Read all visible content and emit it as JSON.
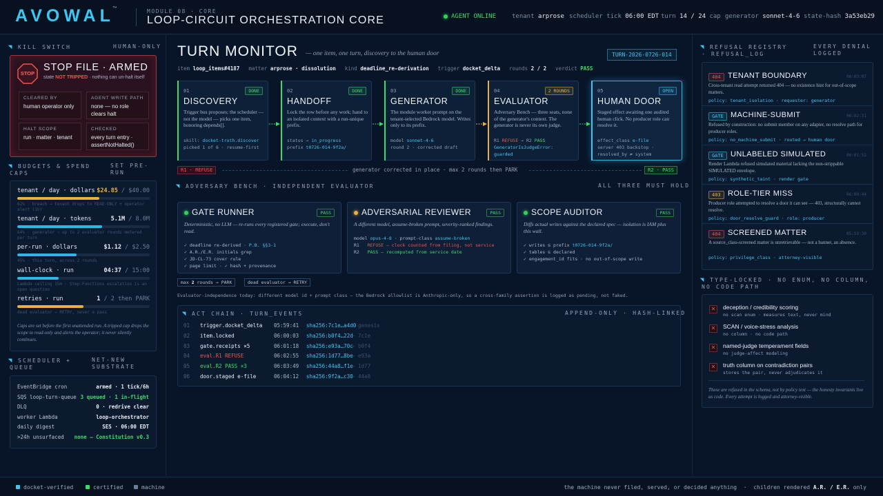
{
  "header": {
    "brand": "AVOWAL",
    "tm": "™",
    "module": "MODULE 08 · CORE",
    "title": "LOOP-CIRCUIT ORCHESTRATION CORE",
    "agent": "AGENT ONLINE",
    "tenant_l": "tenant",
    "tenant_v": "arprose",
    "tick_l": "scheduler tick",
    "tick_v": "06:00 EDT",
    "turn_l": "turn",
    "turn_v": "14 / 24",
    "turn_s": "cap",
    "gen_l": "generator",
    "gen_v": "sonnet-4-6",
    "hash_l": "state-hash",
    "hash_v": "3a53eb29"
  },
  "kill": {
    "head": "KILL SWITCH",
    "mode": "HUMAN-ONLY",
    "stop": "STOP",
    "title": "STOP FILE · ARMED",
    "sub1": "state",
    "sub2": "NOT TRIPPED",
    "sub3": "· nothing can un-halt itself",
    "b1l": "CLEARED BY",
    "b1v": "human operator only",
    "b2l": "AGENT WRITE PATH",
    "b2v": "none — no role clears halt",
    "b3l": "HALT SCOPE",
    "b3v": "run · matter · tenant",
    "b4l": "CHECKED",
    "b4v": "every turn entry · assertNotHalted()"
  },
  "budgets": {
    "head": "BUDGETS & SPEND CAPS",
    "right": "SET PRE-RUN",
    "rows": [
      {
        "label": "tenant / day · dollars",
        "value": "$24.85",
        "cap": "/ $40.00",
        "note": "62% · breach → tenant drops to READ-ONLY + operator alert (1h)",
        "fill": 0.62,
        "color": "#eab13d"
      },
      {
        "label": "tenant / day · tokens",
        "value": "5.1M",
        "cap": "/ 8.0M",
        "note": "64% · generator ~ up to 2 evaluator rounds metered per turn",
        "fill": 0.64,
        "color": "#30b6e6"
      },
      {
        "label": "per-run · dollars",
        "value": "$1.12",
        "cap": "/ $2.50",
        "note": "45% · this turn, across 2 rounds",
        "fill": 0.45,
        "color": "#30b6e6"
      },
      {
        "label": "wall-clock · run",
        "value": "04:37",
        "cap": "/ 15:00",
        "note": "Lambda ceiling 15m · Step-Functions escalation is an open question",
        "fill": 0.31,
        "color": "#30b6e6"
      },
      {
        "label": "retries · run",
        "value": "1",
        "cap": "/ 2  then PARK",
        "note": "dead evaluator → RETRY, never a pass",
        "fill": 0.5,
        "color": "#eab13d"
      }
    ],
    "foot": "Caps are set before the first unattended run. A tripped cap drops the scope to read-only and alerts the operator; it never silently continues."
  },
  "sched": {
    "head": "SCHEDULER + QUEUE",
    "right": "NET-NEW SUBSTRATE",
    "rows": [
      {
        "k": "EventBridge cron",
        "v": "armed · 1 tick/6h",
        "c": "#e8eef8"
      },
      {
        "k": "SQS loop-turn-queue",
        "v": "3 queued · 1 in-flight",
        "c": "#3ddc6a"
      },
      {
        "k": "DLQ",
        "v": "0 · redrive clear",
        "c": "#e8eef8"
      },
      {
        "k": "worker Lambda",
        "v": "loop-orchestrator",
        "c": "#e8eef8"
      },
      {
        "k": "daily digest",
        "v": "SES · 06:00 EDT",
        "c": "#e8eef8"
      },
      {
        "k": ">24h unsurfaced",
        "v": "none — Constitution v0.3",
        "c": "#3ddc6a"
      }
    ]
  },
  "turn": {
    "title": "TURN MONITOR",
    "tag": "— one item, one turn, discovery to the human door",
    "id": "TURN-2026-0726-014",
    "meta": [
      {
        "k": "item",
        "v": "loop_items#4187"
      },
      {
        "k": "matter",
        "v": "arprose · dissolution"
      },
      {
        "k": "kind",
        "v": "deadline_re-derivation"
      },
      {
        "k": "trigger",
        "v": "docket_delta"
      },
      {
        "k": "rounds",
        "v": "2 / 2"
      },
      {
        "k": "verdict",
        "v": "PASS"
      }
    ]
  },
  "stages": [
    {
      "num": "01",
      "badge": "DONE",
      "title": "DISCOVERY",
      "desc": "Trigger bus proposes; the scheduler — not the model — picks one item, honoring depends[].",
      "m1": "skill: ",
      "m1v": "docket-truth.discover",
      "m2": "picked 1 of 6 · resume-first"
    },
    {
      "num": "02",
      "badge": "DONE",
      "title": "HANDOFF",
      "desc": "Lock the row before any work; hand to an isolated context with a run-unique prefix.",
      "m1": "status → ",
      "m1v": "in_progress",
      "m2": "prefix ",
      "m2v": "t0726-014-9f2a/"
    },
    {
      "num": "03",
      "badge": "DONE",
      "title": "GENERATOR",
      "desc": "The module worker prompt on the tenant-selected Bedrock model. Writes only to its prefix.",
      "m1": "model ",
      "m1v": "sonnet-4-6",
      "m2": "round 2 · corrected draft"
    },
    {
      "num": "04",
      "badge": "2 ROUNDS",
      "title": "EVALUATOR",
      "desc": "Adversary Bench — three seats, none of the generator's context. The generator is never its own judge.",
      "m1": "R1 ",
      "m1r": "REFUSE",
      "m1b": " → R2 ",
      "m1g": "PASS",
      "m2v": "GeneratorIsJudgeError:",
      "m3v": "guarded"
    },
    {
      "num": "05",
      "badge": "OPEN",
      "title": "HUMAN DOOR",
      "desc": "Staged effect awaiting one audited human click. No producer role can resolve it.",
      "m1": "effect_class ",
      "m1v": "e-file",
      "m2": "server 403 backstop ·",
      "m3": "resolved_by ≠ system"
    }
  ],
  "rounds": {
    "r1": "R1 · REFUSE",
    "mid": "generator corrected in place · max 2 rounds then PARK",
    "r2": "R2 · PASS"
  },
  "bench": {
    "head": "ADVERSARY BENCH · INDEPENDENT EVALUATOR",
    "right": "ALL THREE MUST HOLD",
    "pass": "PASS",
    "gate": {
      "title": "GATE RUNNER",
      "desc": "Deterministic, no LLM — re-runs every registered gate; execute, don't read.",
      "lines": [
        "✓ deadline re-derived · ",
        "✓ A.R./E.R. initials grep",
        "✓ JD-CL-73 cover rule",
        "✓ page limit · ✓ hash + provenance"
      ],
      "l1v": "P.B. §§3-1"
    },
    "adv": {
      "title": "ADVERSARIAL REVIEWER",
      "desc": "A different model, assume-broken prompt, severity-ranked findings.",
      "model_l": "model ",
      "model_v": "opus-4-8",
      "pc_l": " · prompt-class ",
      "pc_v": "assume-broken",
      "r1": "R1",
      "r1v": "REFUSE — clock counted from filing, not service",
      "r2": "R2",
      "r2v": "PASS — recomputed from service date"
    },
    "scope": {
      "title": "SCOPE AUDITOR",
      "desc": "Diffs actual writes against the declared spec — isolation is IAM plus this wall.",
      "l1": "✓ writes ⊆ prefix ",
      "l1v": "t0726-014-9f2a/",
      "l2": "✓ tables ⊆ declared",
      "l3": "✓ engagement_id fits · no out-of-scope write"
    },
    "chip1a": "max ",
    "chip1b": "2",
    "chip1c": " rounds → PARK",
    "chip2": "dead evaluator → RETRY",
    "note": "Evaluator-independence today: different model id + prompt class — the Bedrock allowlist is Anthropic-only, so a cross-family assertion is logged as pending, not faked."
  },
  "chain": {
    "head": "ACT CHAIN · TURN_EVENTS",
    "right": "APPEND-ONLY · HASH-LINKED",
    "rows": [
      {
        "n": "01",
        "ev": "trigger.docket_delta",
        "t": "05:59:41",
        "h": "sha256:7c1e…a4d0",
        "p": "← genesis",
        "c": "#e8eef8"
      },
      {
        "n": "02",
        "ev": "item.locked",
        "t": "06:00:03",
        "h": "sha256:b0f4…22d",
        "p": "← 7c1e",
        "c": "#e8eef8"
      },
      {
        "n": "03",
        "ev": "gate.receipts ×5",
        "t": "06:01:18",
        "h": "sha256:e93a…70c",
        "p": "← b0f4",
        "c": "#e8eef8"
      },
      {
        "n": "04",
        "ev": "eval.R1 REFUSE",
        "t": "06:02:55",
        "h": "sha256:1d77…8be",
        "p": "← e93a",
        "c": "#f2534d"
      },
      {
        "n": "05",
        "ev": "eval.R2 PASS ×3",
        "t": "06:03:49",
        "h": "sha256:44a8…f1e",
        "p": "← 1d77",
        "c": "#3ddc6a"
      },
      {
        "n": "06",
        "ev": "door.staged e-file",
        "t": "06:04:12",
        "h": "sha256:9f2a…c30",
        "p": "← 44a8",
        "c": "#e8eef8"
      }
    ]
  },
  "registry": {
    "head": "REFUSAL REGISTRY · REFUSAL_LOG",
    "right": "EVERY DENIAL LOGGED",
    "items": [
      {
        "code": "404",
        "title": "TENANT BOUNDARY",
        "ts": "06:03:07",
        "desc": "Cross-tenant read attempt returned 404 — no existence hint for out-of-scope matters.",
        "pol": "policy: tenant_isolation · requester: generator",
        "cc": "#f2534d"
      },
      {
        "code": "GATE",
        "title": "MACHINE-SUBMIT",
        "ts": "06:02:31",
        "desc": "Refused by construction: no submit member on any adapter, no resolve path for producer roles.",
        "pol": "policy: no_machine_submit · routed → human door",
        "cc": "#3fc6f0"
      },
      {
        "code": "GATE",
        "title": "UNLABELED SIMULATED",
        "ts": "06:01:52",
        "desc": "Render Lambda refused simulated material lacking the non-strippable SIMULATED envelope.",
        "pol": "policy: synthetic_taint · render gate",
        "cc": "#3fc6f0"
      },
      {
        "code": "403",
        "title": "ROLE-TIER MISS",
        "ts": "06:00:44",
        "desc": "Producer role attempted to resolve a door it can see — 403, structurally cannot resolve.",
        "pol": "policy: door_resolve_guard · role: producer",
        "cc": "#eab13d"
      },
      {
        "code": "404",
        "title": "SCREENED MATTER",
        "ts": "05:59:30",
        "desc": "A source_class-screened matter is unretrievable — not a banner, an absence.",
        "pol": "policy: privilege_class · attorney-visible",
        "cc": "#f2534d"
      }
    ]
  },
  "typelocked": {
    "head": "TYPE-LOCKED · NO ENUM, NO COLUMN, NO CODE PATH",
    "items": [
      {
        "t": "deception / credibility scoring",
        "s": "no scan enum · measures text, never mind"
      },
      {
        "t": "SCAN / voice-stress analysis",
        "s": "no column · no code path"
      },
      {
        "t": "named-judge temperament fields",
        "s": "no judge-affect modeling"
      },
      {
        "t": "truth column on contradiction pairs",
        "s": "stores the pair, never adjudicates it"
      }
    ],
    "foot": "These are refused in the schema, not by policy text — the honesty invariants live as code. Every attempt is logged and attorney-visible."
  },
  "footer": {
    "l1": "docket-verified",
    "l2": "certified",
    "l3": "machine",
    "right1": "the machine never filed, served, or decided anything",
    "dot": "·",
    "right2": "children rendered ",
    "right3": "A.R. / E.R.",
    "right4": " only"
  }
}
